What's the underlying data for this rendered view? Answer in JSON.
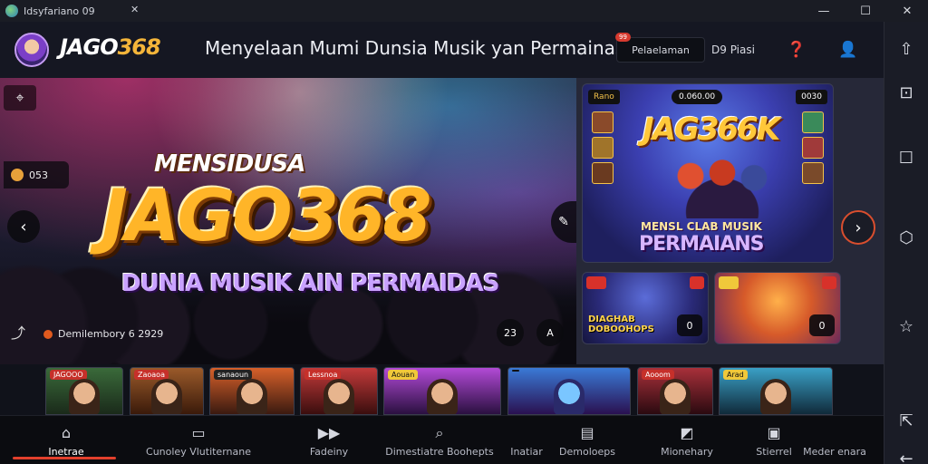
{
  "window": {
    "title": "Idsyfariano 09",
    "pin_icon": "pin-icon",
    "minimize": "—",
    "maximize": "☐",
    "close": "✕"
  },
  "header": {
    "brand_part1": "JAGO",
    "brand_part2": "368",
    "headline": "Menyelaan Mumi  Dunsia Musik yan Permainas",
    "login_label": "Pelaelaman",
    "login_badge": "99",
    "daftar_label": "D9 Piasi",
    "help_icon": "❓",
    "profile_icon": "👤"
  },
  "hero": {
    "kicker": "MENSIDUSA",
    "title": "JAGO368",
    "subtitle": "DUNIA MUSIK AIN PERMAIDAS",
    "counter": "053",
    "caption": "Demilembory  6  2929",
    "ctrl_1": "23",
    "ctrl_2": "A"
  },
  "side": {
    "promo_main": {
      "tag_left": "Rano",
      "tag_center": "0.060.00",
      "tag_right": "0030",
      "title": "JAG366K",
      "sub1": "MENSL CLAB MUSIK",
      "sub2": "PERMAIANS"
    },
    "promo_small_1": {
      "text_1": "DIAGHAB",
      "text_2": "DOBOOHOPS",
      "button": "0"
    },
    "promo_small_2": {
      "button": "0"
    }
  },
  "games": [
    {
      "tag": "JAGOOO"
    },
    {
      "tag": "Zaoaoa"
    },
    {
      "tag": "sanaoun"
    },
    {
      "tag": "Lessnoa"
    },
    {
      "tag": "Aouan"
    },
    {
      "tag": ""
    },
    {
      "tag": "Aooom"
    },
    {
      "tag": "Arad"
    }
  ],
  "nav": {
    "items": [
      {
        "label": "Inetrae",
        "icon": "⌂"
      },
      {
        "label": "Cunoley Vlutiternane",
        "icon": "▭"
      },
      {
        "label": "Fadeiny",
        "icon": "▶▶"
      },
      {
        "label": "Dimestiatre Boohepts",
        "icon": "⌕"
      },
      {
        "label": "Inatiar",
        "icon": ""
      },
      {
        "label": "Demoloeps",
        "icon": "▤"
      },
      {
        "label": "Mionehary",
        "icon": "◩"
      },
      {
        "label": "Stierrel",
        "icon": "▣"
      },
      {
        "label": "Meder enara",
        "icon": ""
      }
    ]
  },
  "colors": {
    "accent": "#e2402c",
    "brand_gold": "#f4b53a",
    "background": "#12141c"
  }
}
